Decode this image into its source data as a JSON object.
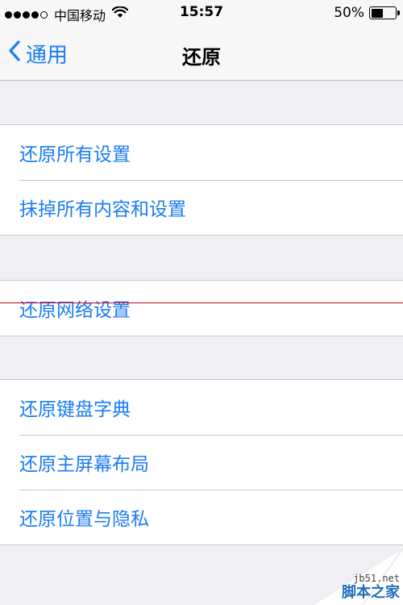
{
  "status_bar": {
    "carrier": "中国移动",
    "time": "15:57",
    "battery_text": "50%",
    "battery_level": 0.5,
    "signal_bars_filled": 4,
    "signal_bars_total": 5
  },
  "nav": {
    "back_label": "通用",
    "title": "还原"
  },
  "groups": [
    {
      "items": [
        {
          "label": "还原所有设置"
        },
        {
          "label": "抹掉所有内容和设置"
        }
      ]
    },
    {
      "items": [
        {
          "label": "还原网络设置"
        }
      ]
    },
    {
      "items": [
        {
          "label": "还原键盘字典"
        },
        {
          "label": "还原主屏幕布局"
        },
        {
          "label": "还原位置与隐私"
        }
      ]
    }
  ],
  "watermark": {
    "url": "jb51.net",
    "brand": "脚本之家"
  },
  "colors": {
    "accent": "#1a7cf4",
    "background": "#efeff4",
    "annotation_line": "#d0021b"
  },
  "icons": [
    "wifi-icon",
    "chevron-left-icon",
    "battery-icon"
  ]
}
